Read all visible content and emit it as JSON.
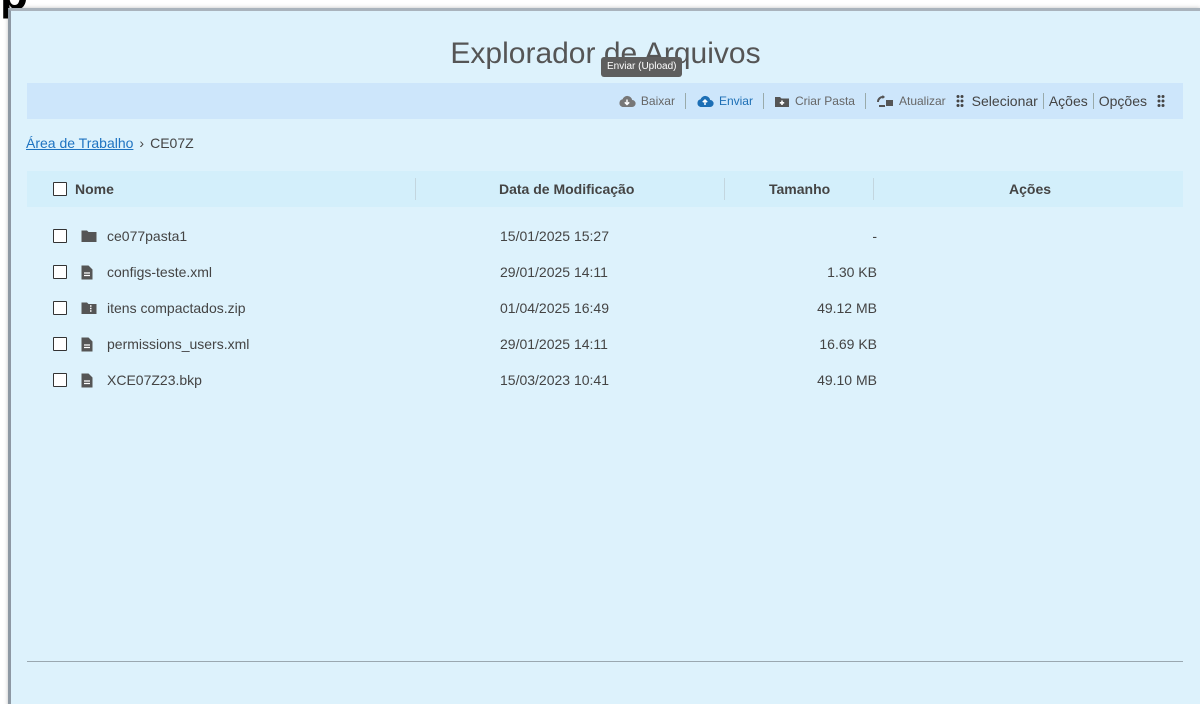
{
  "window": {
    "title": "Explorador de Arquivos",
    "tooltip": "Enviar (Upload)"
  },
  "toolbar": {
    "download_label": "Baixar",
    "upload_label": "Enviar",
    "new_folder_label": "Criar Pasta",
    "refresh_label": "Atualizar",
    "select_label": "Selecionar",
    "actions_label": "Ações",
    "options_label": "Opções"
  },
  "breadcrumb": {
    "root": "Área de Trabalho",
    "separator": "›",
    "current": "CE07Z"
  },
  "table": {
    "headers": {
      "name": "Nome",
      "modified": "Data de Modificação",
      "size": "Tamanho",
      "actions": "Ações"
    },
    "rows": [
      {
        "name": "ce077pasta1",
        "modified": "15/01/2025 15:27",
        "size": "-",
        "icon": "folder-icon"
      },
      {
        "name": "configs-teste.xml",
        "modified": "29/01/2025 14:11",
        "size": "1.30 KB",
        "icon": "file-icon"
      },
      {
        "name": "itens compactados.zip",
        "modified": "01/04/2025 16:49",
        "size": "49.12 MB",
        "icon": "zip-icon"
      },
      {
        "name": "permissions_users.xml",
        "modified": "29/01/2025 14:11",
        "size": "16.69 KB",
        "icon": "file-icon"
      },
      {
        "name": "XCE07Z23.bkp",
        "modified": "15/03/2023 10:41",
        "size": "49.10 MB",
        "icon": "file-icon"
      }
    ]
  },
  "colors": {
    "background": "#ddf2fc",
    "toolbar": "#cde6fb",
    "header": "#d3effb",
    "link": "#1e73c1"
  }
}
